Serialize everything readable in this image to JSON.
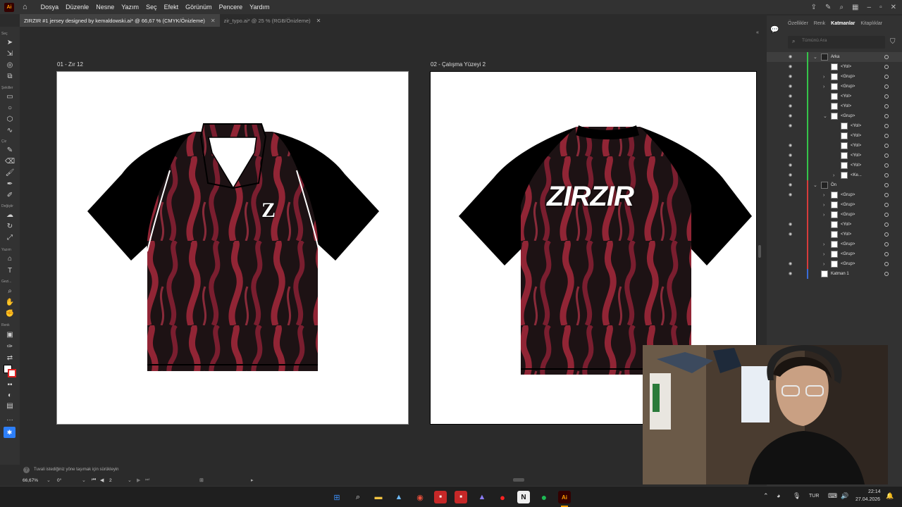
{
  "app": {
    "logo": "Ai",
    "accent": "#ff9a00"
  },
  "menu": [
    "Dosya",
    "Düzenle",
    "Nesne",
    "Yazım",
    "Seç",
    "Efekt",
    "Görünüm",
    "Pencere",
    "Yardım"
  ],
  "tabs": [
    {
      "label": "ZIRZIR #1 jersey designed by kemaldowski.ai* @ 66,67 % (CMYK/Önizleme)",
      "active": true
    },
    {
      "label": "zir_typo.ai* @ 25 % (RGB/Önizleme)",
      "active": false
    }
  ],
  "toolbar_labels": {
    "selection": "Seç",
    "shapes": "Şekiller",
    "draw": "Çiz",
    "modify": "Değiştir",
    "type": "Yazım",
    "nav": "Gezi...",
    "color": "Renk"
  },
  "artboards": [
    {
      "label": "01 - Zır 12"
    },
    {
      "label": "02 - Çalışma Yüzeyi 2"
    }
  ],
  "back_text": "ZIRZIR",
  "front_logo": "Z",
  "status": {
    "hint": "Tuvali istediğiniz yöne taşımak için sürükleyin",
    "zoom": "66,67%",
    "rotation": "0°",
    "artboard_num": "2"
  },
  "panel": {
    "tabs": [
      "Özellikler",
      "Renk",
      "Katmanlar",
      "Kitaplıklar"
    ],
    "active_tab": "Katmanlar",
    "search_placeholder": "Tümünü Ara"
  },
  "layers": [
    {
      "name": "Arka",
      "level": 0,
      "expanded": true,
      "color": "#35c44a",
      "eye": true,
      "selected": true
    },
    {
      "name": "<Yol>",
      "level": 1,
      "color": "#35c44a",
      "eye": true
    },
    {
      "name": "<Grup>",
      "level": 1,
      "chev": true,
      "color": "#35c44a",
      "eye": true
    },
    {
      "name": "<Grup>",
      "level": 1,
      "chev": true,
      "color": "#35c44a",
      "eye": true
    },
    {
      "name": "<Yol>",
      "level": 1,
      "color": "#35c44a",
      "eye": true
    },
    {
      "name": "<Yol>",
      "level": 1,
      "color": "#35c44a",
      "eye": true
    },
    {
      "name": "<Grup>",
      "level": 1,
      "expanded": true,
      "color": "#35c44a",
      "eye": true
    },
    {
      "name": "<Yol>",
      "level": 2,
      "color": "#35c44a",
      "eye": true
    },
    {
      "name": "<Yol>",
      "level": 2,
      "color": "#35c44a",
      "eye": false
    },
    {
      "name": "<Yol>",
      "level": 2,
      "color": "#35c44a",
      "eye": true
    },
    {
      "name": "<Yol>",
      "level": 2,
      "color": "#35c44a",
      "eye": true
    },
    {
      "name": "<Yol>",
      "level": 2,
      "color": "#35c44a",
      "eye": true
    },
    {
      "name": "<Ke...",
      "level": 2,
      "chev": true,
      "color": "#35c44a",
      "eye": true
    },
    {
      "name": "Ön",
      "level": 0,
      "expanded": true,
      "color": "#d83b3b",
      "eye": true
    },
    {
      "name": "<Grup>",
      "level": 1,
      "chev": true,
      "color": "#d83b3b",
      "eye": true
    },
    {
      "name": "<Grup>",
      "level": 1,
      "chev": true,
      "color": "#d83b3b",
      "eye": false
    },
    {
      "name": "<Grup>",
      "level": 1,
      "chev": true,
      "color": "#d83b3b",
      "eye": false
    },
    {
      "name": "<Yol>",
      "level": 1,
      "color": "#d83b3b",
      "eye": true
    },
    {
      "name": "<Yol>",
      "level": 1,
      "color": "#d83b3b",
      "eye": true
    },
    {
      "name": "<Grup>",
      "level": 1,
      "chev": true,
      "color": "#d83b3b",
      "eye": false
    },
    {
      "name": "<Grup>",
      "level": 1,
      "chev": true,
      "color": "#d83b3b",
      "eye": false
    },
    {
      "name": "<Grup>",
      "level": 1,
      "chev": true,
      "color": "#d83b3b",
      "eye": true
    },
    {
      "name": "Katman 1",
      "level": 0,
      "color": "#3a6cd8",
      "eye": true
    }
  ],
  "taskbar": {
    "lang": "TUR",
    "time": "22:14",
    "date": "27.04.2026"
  }
}
